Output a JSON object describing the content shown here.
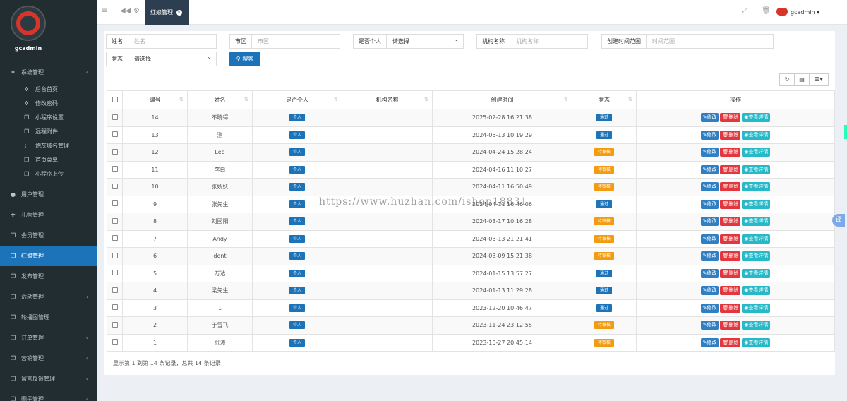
{
  "brand": {
    "name": "gcadmin"
  },
  "sidebar": {
    "items": [
      {
        "label": "系统管理",
        "icon": "gears-icon",
        "caret": "‹"
      },
      {
        "label": "后台首页",
        "icon": "gears-icon"
      },
      {
        "label": "修改密码",
        "icon": "gears-icon"
      },
      {
        "label": "小程序设置",
        "icon": "file-icon"
      },
      {
        "label": "远程附件",
        "icon": "file-icon"
      },
      {
        "label": "炮灰域名管理",
        "icon": "paperclip-icon"
      },
      {
        "label": "首页菜单",
        "icon": "file-icon"
      },
      {
        "label": "小程序上传",
        "icon": "file-icon"
      },
      {
        "label": "用户管理",
        "icon": "user-icon"
      },
      {
        "label": "礼物管理",
        "icon": "gift-icon"
      },
      {
        "label": "会员管理",
        "icon": "file-icon"
      },
      {
        "label": "红娘管理",
        "icon": "file-icon"
      },
      {
        "label": "发布管理",
        "icon": "file-icon"
      },
      {
        "label": "活动管理",
        "icon": "file-icon",
        "caret": "‹"
      },
      {
        "label": "轮播图管理",
        "icon": "file-icon"
      },
      {
        "label": "订单管理",
        "icon": "file-icon",
        "caret": "‹"
      },
      {
        "label": "营销管理",
        "icon": "file-icon",
        "caret": "‹"
      },
      {
        "label": "留言反馈管理",
        "icon": "file-icon",
        "caret": "‹"
      },
      {
        "label": "圈子管理",
        "icon": "file-icon",
        "caret": "‹"
      }
    ]
  },
  "topbar": {
    "tab_label": "红娘管理",
    "tab_close": "×",
    "user_name": "gcadmin ▾"
  },
  "filters": {
    "name_label": "姓名",
    "name_placeholder": "姓名",
    "city_label": "市区",
    "city_placeholder": "市区",
    "personal_label": "是否个人",
    "personal_value": "请选择",
    "org_label": "机构名称",
    "org_placeholder": "机构名称",
    "time_label": "创建时间范围",
    "time_placeholder": "时间范围",
    "status_label": "状态",
    "status_value": "请选择",
    "search_button": "搜索"
  },
  "table": {
    "headers": [
      "编号",
      "姓名",
      "是否个人",
      "机构名称",
      "创建时间",
      "状态",
      "操作"
    ],
    "actions": {
      "edit": "修改",
      "delete": "删除",
      "view": "查看详情"
    },
    "rows": [
      {
        "id": "14",
        "name": "不晓得",
        "personal": "个人",
        "org": "",
        "time": "2025-02-28 16:21:38",
        "status": "通过",
        "ok": true
      },
      {
        "id": "13",
        "name": "测",
        "personal": "个人",
        "org": "",
        "time": "2024-05-13 10:19:29",
        "status": "通过",
        "ok": true
      },
      {
        "id": "12",
        "name": "Leo",
        "personal": "个人",
        "org": "",
        "time": "2024-04-24 15:28:24",
        "status": "待审核",
        "ok": false
      },
      {
        "id": "11",
        "name": "李白",
        "personal": "个人",
        "org": "",
        "time": "2024-04-16 11:10:27",
        "status": "待审核",
        "ok": false
      },
      {
        "id": "10",
        "name": "张妩妩",
        "personal": "个人",
        "org": "",
        "time": "2024-04-11 16:50:49",
        "status": "待审核",
        "ok": false
      },
      {
        "id": "9",
        "name": "张先生",
        "personal": "个人",
        "org": "",
        "time": "2024-04-11 16:46:06",
        "status": "通过",
        "ok": true
      },
      {
        "id": "8",
        "name": "刘國阳",
        "personal": "个人",
        "org": "",
        "time": "2024-03-17 10:16:28",
        "status": "待审核",
        "ok": false
      },
      {
        "id": "7",
        "name": "Andy",
        "personal": "个人",
        "org": "",
        "time": "2024-03-13 21:21:41",
        "status": "待审核",
        "ok": false
      },
      {
        "id": "6",
        "name": "dont",
        "personal": "个人",
        "org": "",
        "time": "2024-03-09 15:21:38",
        "status": "待审核",
        "ok": false
      },
      {
        "id": "5",
        "name": "万达",
        "personal": "个人",
        "org": "",
        "time": "2024-01-15 13:57:27",
        "status": "通过",
        "ok": true
      },
      {
        "id": "4",
        "name": "梁先生",
        "personal": "个人",
        "org": "",
        "time": "2024-01-13 11:29:28",
        "status": "通过",
        "ok": true
      },
      {
        "id": "3",
        "name": "1",
        "personal": "个人",
        "org": "",
        "time": "2023-12-20 10:46:47",
        "status": "通过",
        "ok": true
      },
      {
        "id": "2",
        "name": "于雪飞",
        "personal": "个人",
        "org": "",
        "time": "2023-11-24 23:12:55",
        "status": "待审核",
        "ok": false
      },
      {
        "id": "1",
        "name": "张涛",
        "personal": "个人",
        "org": "",
        "time": "2023-10-27 20:45:14",
        "status": "待审核",
        "ok": false
      }
    ]
  },
  "pagination": {
    "summary": "显示第 1 到第 14 条记录，总共 14 条记录"
  },
  "watermark": "https://www.huzhan.com/ishop18831",
  "translate_button": "译",
  "colors": {
    "sidebar_bg": "#222d32",
    "accent": "#1c73b8",
    "pending": "#f39c12",
    "danger": "#e3373d",
    "info": "#27b9c8"
  }
}
